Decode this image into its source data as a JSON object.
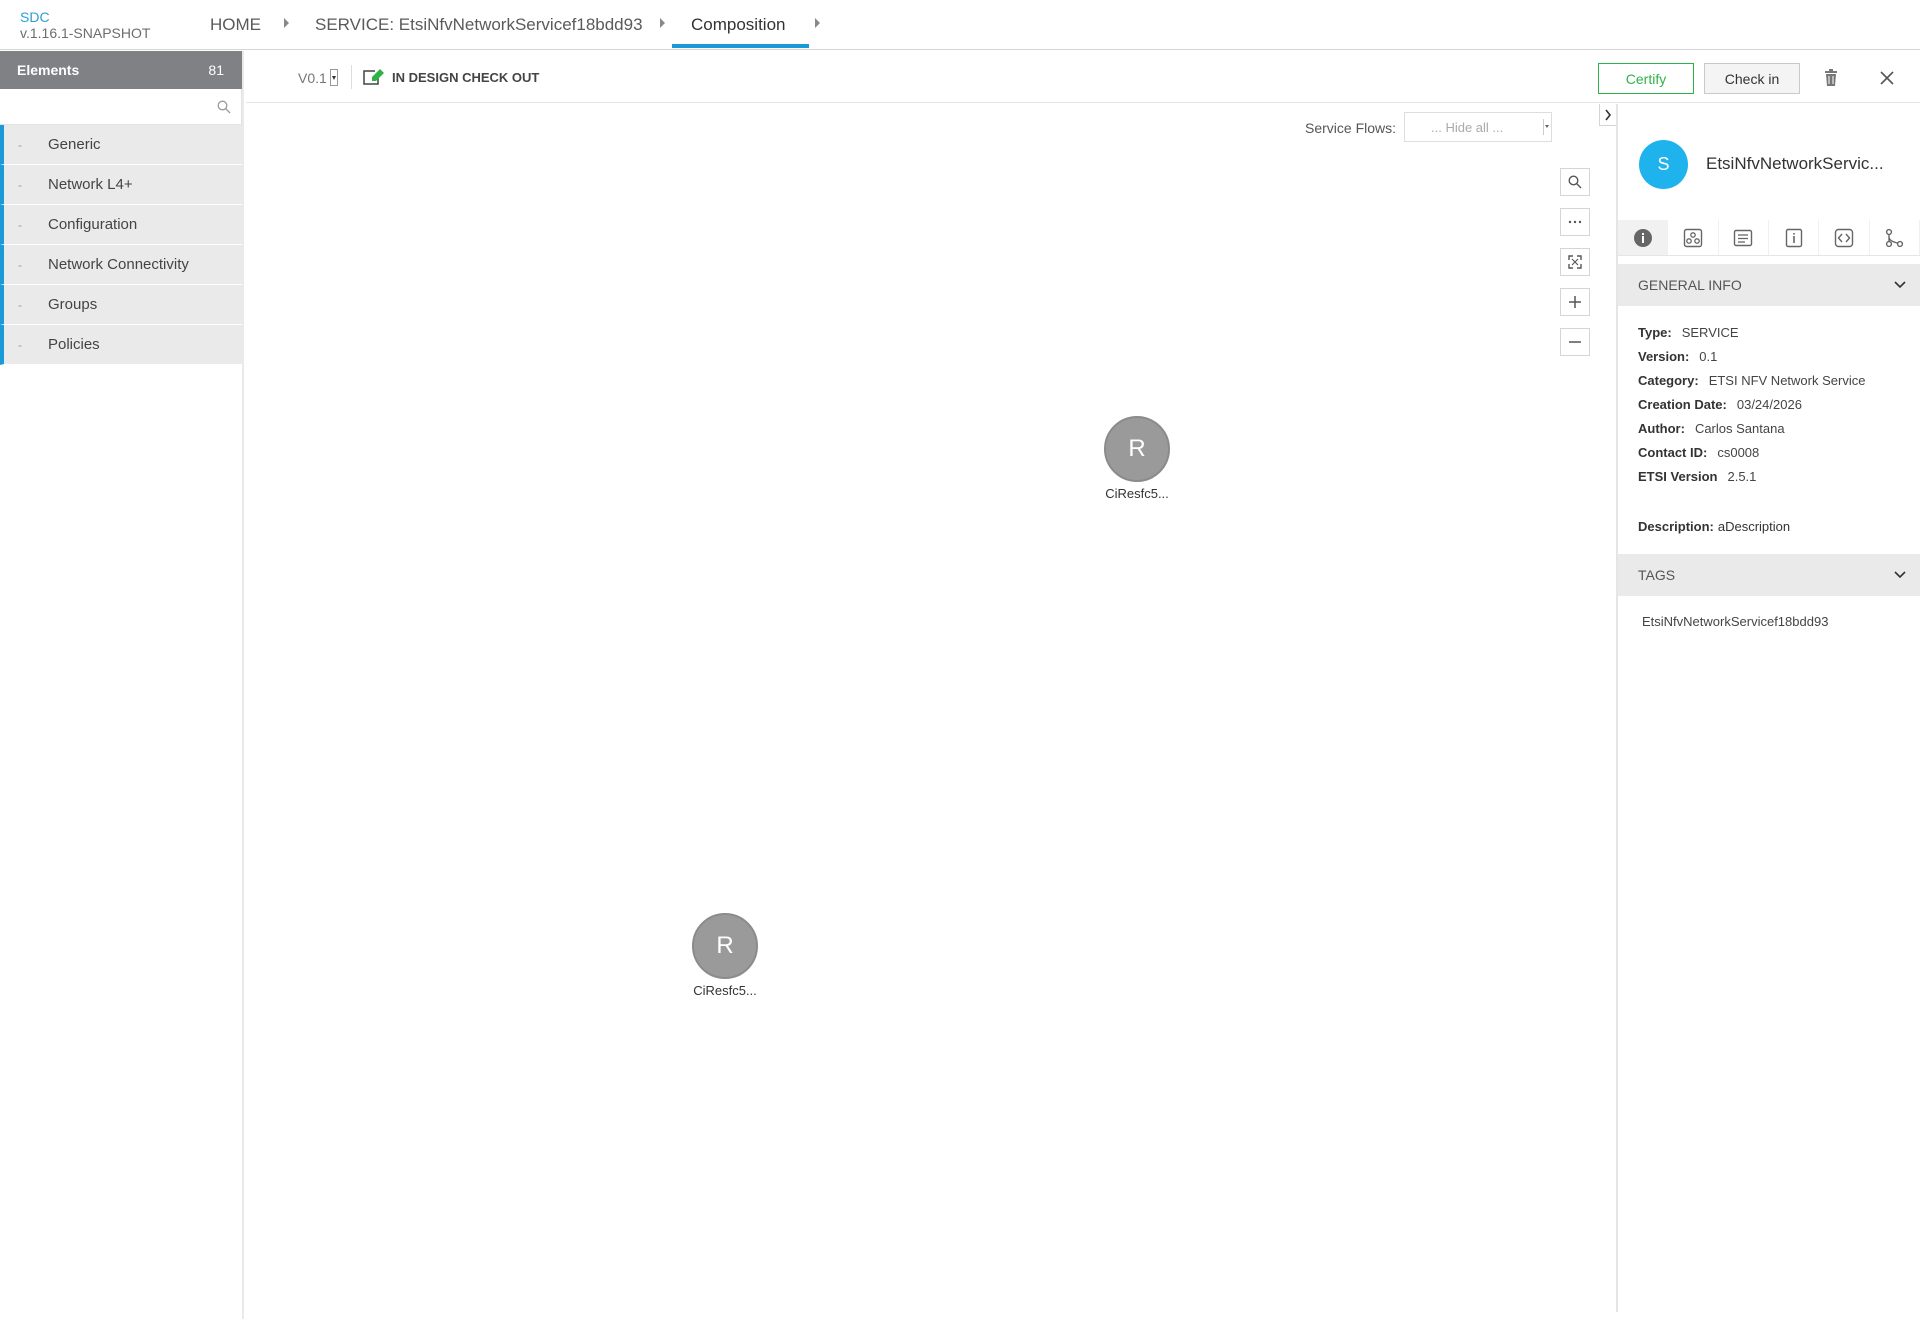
{
  "app": {
    "name": "SDC",
    "version": "v.1.16.1-SNAPSHOT"
  },
  "breadcrumb": {
    "home": "HOME",
    "service": "SERVICE: EtsiNfvNetworkServicef18bdd93",
    "current": "Composition"
  },
  "palette": {
    "title": "Elements",
    "count": "81",
    "search_placeholder": "",
    "items": [
      {
        "dash": "-",
        "label": "Generic"
      },
      {
        "dash": "-",
        "label": "Network L4+"
      },
      {
        "dash": "-",
        "label": "Configuration"
      },
      {
        "dash": "-",
        "label": "Network Connectivity"
      },
      {
        "dash": "-",
        "label": "Groups"
      },
      {
        "dash": "-",
        "label": "Policies"
      }
    ]
  },
  "toolbar": {
    "version": "V0.1",
    "status": "IN DESIGN CHECK OUT",
    "certify_label": "Certify",
    "checkin_label": "Check in"
  },
  "canvas": {
    "service_flows_label": "Service Flows:",
    "service_flows_value": "... Hide all ...",
    "nodes": [
      {
        "letter": "R",
        "label": "CiResfc5..."
      },
      {
        "letter": "R",
        "label": "CiResfc5..."
      }
    ]
  },
  "details": {
    "avatar_letter": "S",
    "title": "EtsiNfvNetworkServic...",
    "general_info_title": "GENERAL INFO",
    "info": [
      {
        "key": "Type:",
        "value": "SERVICE"
      },
      {
        "key": "Version:",
        "value": "0.1"
      },
      {
        "key": "Category:",
        "value": "ETSI NFV Network Service"
      },
      {
        "key": "Creation Date:",
        "value": "03/24/2026"
      },
      {
        "key": "Author:",
        "value": "Carlos Santana"
      },
      {
        "key": "Contact ID:",
        "value": "cs0008"
      },
      {
        "key": "ETSI Version",
        "value": "2.5.1"
      }
    ],
    "description_key": "Description:",
    "description_value": "aDescription",
    "tags_title": "TAGS",
    "tag": "EtsiNfvNetworkServicef18bdd93"
  },
  "colors": {
    "accent": "#1a9ad6",
    "certify": "#2db34a",
    "avatar": "#1fb3ed",
    "node": "#9a9a9a",
    "palette_header": "#7f8184"
  }
}
